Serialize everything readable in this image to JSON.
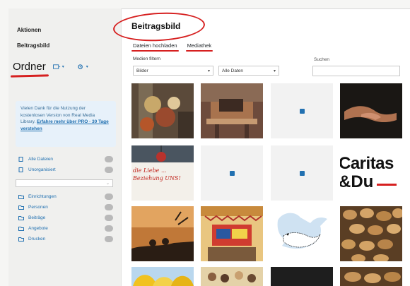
{
  "sidebar": {
    "section_label": "Aktionen",
    "subtitle": "Beitragsbild",
    "ordner_label": "Ordner",
    "notice_text": "Vielen Dank für die Nutzung der kostenlosen Version von Real Media Library.",
    "notice_link": "Erfahre mehr über PRO · 30 Tage verstehen",
    "folders": [
      {
        "label": "Alle Dateien",
        "count": ""
      },
      {
        "label": "Unorganisiert",
        "count": ""
      },
      {
        "label": "Einrichtungen",
        "count": ""
      },
      {
        "label": "Personen",
        "count": ""
      },
      {
        "label": "Beiträge",
        "count": ""
      },
      {
        "label": "Angebote",
        "count": ""
      },
      {
        "label": "Drucken",
        "count": ""
      }
    ]
  },
  "main": {
    "title": "Beitragsbild",
    "tabs": [
      "Dateien hochladen",
      "Mediathek"
    ],
    "filter_label": "Medien filtern",
    "filter_select": "Bilder",
    "date_select": "Alle Daten",
    "search_label": "Suchen"
  },
  "tiles": [
    {
      "name": "flowers-tile"
    },
    {
      "name": "altar-tile"
    },
    {
      "name": "placeholder-tile"
    },
    {
      "name": "hands-tile"
    },
    {
      "name": "poster-tile",
      "poster_text": "die Liebe ... Beziehung UNS!"
    },
    {
      "name": "placeholder-tile"
    },
    {
      "name": "placeholder-tile"
    },
    {
      "name": "caritas-tile",
      "logo_text_line1": "Caritas",
      "logo_text_line2": "&Du"
    },
    {
      "name": "sunset-tile"
    },
    {
      "name": "flags-tile"
    },
    {
      "name": "dove-tile"
    },
    {
      "name": "bread-tile"
    }
  ],
  "colors": {
    "accent": "#2271b1",
    "annotation_red": "#d62020",
    "notice_bg": "#e7f1fa"
  }
}
